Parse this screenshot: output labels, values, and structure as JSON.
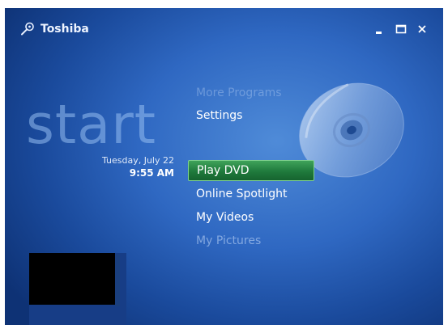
{
  "titlebar": {
    "brand": "Toshiba",
    "brand_icon": "wrench-icon",
    "buttons": [
      {
        "name": "minimize",
        "icon": "minimize-icon"
      },
      {
        "name": "maximize",
        "icon": "maximize-icon"
      },
      {
        "name": "close",
        "icon": "close-icon"
      }
    ]
  },
  "start_label": "start",
  "datetime": {
    "date": "Tuesday, July 22",
    "time": "9:55 AM"
  },
  "menu": {
    "items": [
      {
        "label": "More Programs"
      },
      {
        "label": "Settings"
      },
      {
        "label": "Play DVD",
        "selected": true
      },
      {
        "label": "Online Spotlight"
      },
      {
        "label": "My Videos"
      },
      {
        "label": "My Pictures"
      }
    ]
  },
  "graphics": {
    "disc": "dvd-disc-icon",
    "preview": "now-playing-preview"
  },
  "colors": {
    "background": "#2f68c2",
    "selection": "#1f7a3c",
    "text": "#ffffff"
  }
}
